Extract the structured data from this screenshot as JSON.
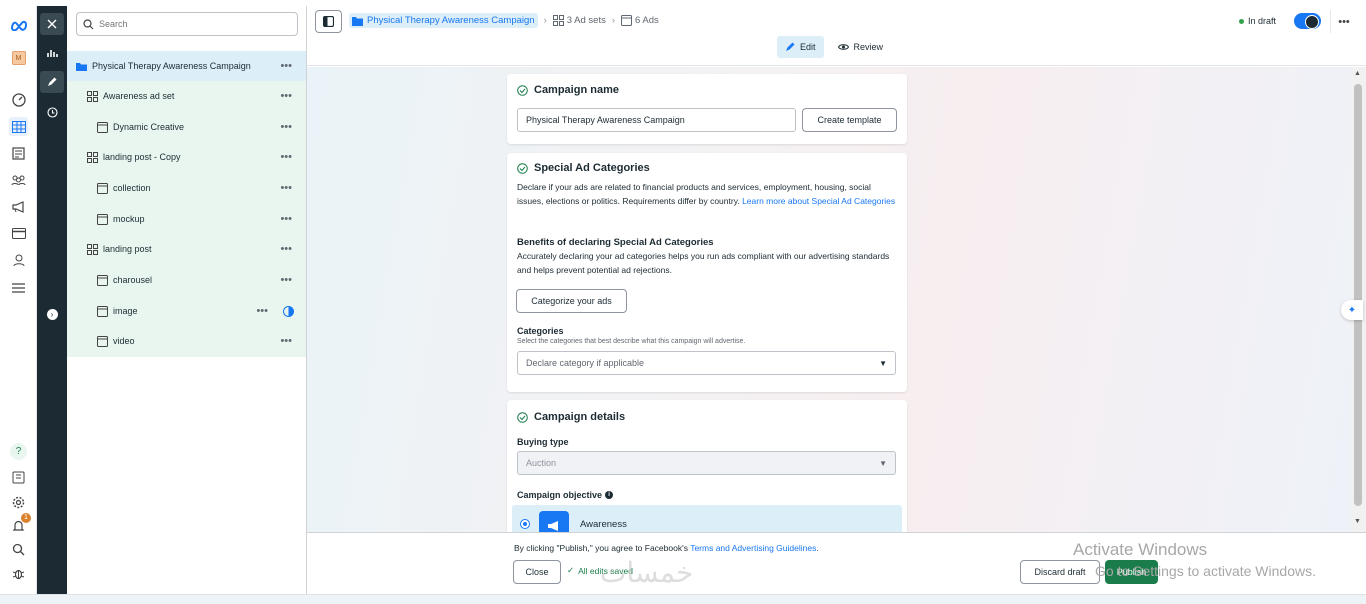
{
  "search": {
    "placeholder": "Search"
  },
  "tree": {
    "items": [
      {
        "label": "Physical Therapy Awareness Campaign",
        "type": "campaign"
      },
      {
        "label": "Awareness ad set",
        "type": "adset"
      },
      {
        "label": "Dynamic Creative",
        "type": "ad"
      },
      {
        "label": "landing post - Copy",
        "type": "adset"
      },
      {
        "label": "collection",
        "type": "ad"
      },
      {
        "label": "mockup",
        "type": "ad"
      },
      {
        "label": "landing post",
        "type": "adset"
      },
      {
        "label": "charousel",
        "type": "ad"
      },
      {
        "label": "image",
        "type": "ad"
      },
      {
        "label": "video",
        "type": "ad"
      }
    ]
  },
  "breadcrumb": {
    "campaign": "Physical Therapy Awareness Campaign",
    "adsets": "3 Ad sets",
    "ads": "6 Ads"
  },
  "status": {
    "label": "In draft"
  },
  "modes": {
    "edit": "Edit",
    "review": "Review"
  },
  "campaign_name": {
    "title": "Campaign name",
    "value": "Physical Therapy Awareness Campaign",
    "create_template": "Create template"
  },
  "special": {
    "title": "Special Ad Categories",
    "description": "Declare if your ads are related to financial products and services, employment, housing, social issues, elections or politics. Requirements differ by country.",
    "learn_more": "Learn more about Special Ad Categories",
    "benefits_title": "Benefits of declaring Special Ad Categories",
    "benefits_text": "Accurately declaring your ad categories helps you run ads compliant with our advertising standards and helps prevent potential ad rejections.",
    "categorize_button": "Categorize your ads",
    "categories_label": "Categories",
    "categories_hint": "Select the categories that best describe what this campaign will advertise.",
    "categories_placeholder": "Declare category if applicable"
  },
  "details": {
    "title": "Campaign details",
    "buying_type_label": "Buying type",
    "buying_type_value": "Auction",
    "objective_label": "Campaign objective",
    "objective_option": "Awareness"
  },
  "footer": {
    "terms_prefix": "By clicking \"Publish,\" you agree to Facebook's",
    "terms_link": "Terms and Advertising Guidelines",
    "terms_suffix": ".",
    "close": "Close",
    "saved": "All edits saved",
    "discard": "Discard draft",
    "publish": "Publish"
  },
  "overlay": {
    "activate_title": "Activate Windows",
    "activate_sub": "Go to Settings to activate Windows.",
    "watermark": "خمسات"
  },
  "notifications": {
    "count": "1"
  },
  "colors": {
    "accent": "#1877f2",
    "publish": "#1a7c4a",
    "dark_rail": "#1c2b33",
    "tree_bg": "#e9f6ef"
  }
}
